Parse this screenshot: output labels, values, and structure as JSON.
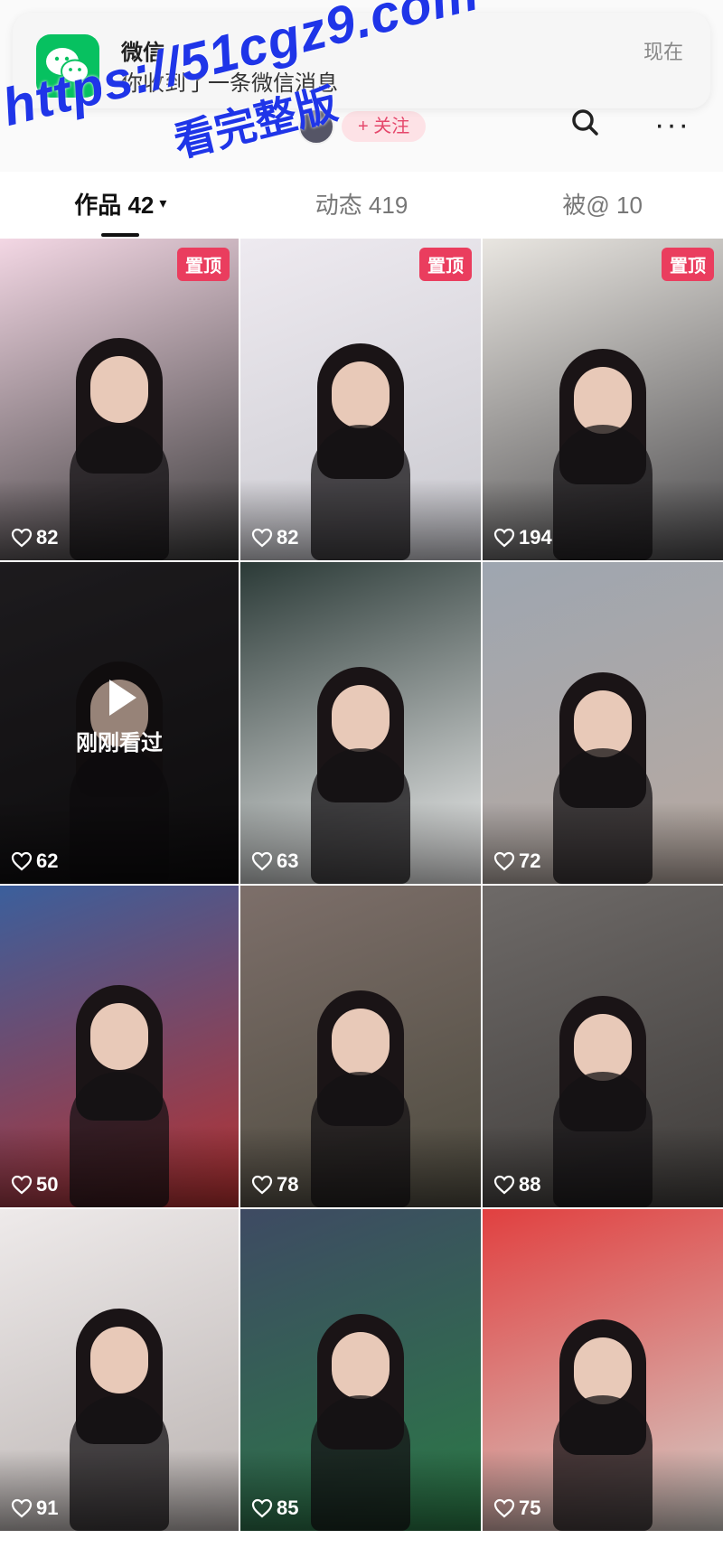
{
  "notification": {
    "app_name": "微信",
    "message": "你收到了一条微信消息",
    "time": "现在"
  },
  "profile": {
    "follow_label": "+ 关注",
    "more_label": "···"
  },
  "tabs": [
    {
      "label": "作品 42",
      "active": true
    },
    {
      "label": "动态 419",
      "active": false
    },
    {
      "label": "被@ 10",
      "active": false
    }
  ],
  "tab_caret": "▾",
  "watermark": {
    "url": "https://51cgz9.com",
    "subtitle": "看完整版"
  },
  "grid": {
    "tiles": [
      {
        "likes": "82",
        "pinned": true,
        "pin_label": "置顶",
        "colors": [
          "#f3d7e4",
          "#3a3a3a"
        ]
      },
      {
        "likes": "82",
        "pinned": true,
        "pin_label": "置顶",
        "colors": [
          "#eeeaf0",
          "#c9c9cf"
        ]
      },
      {
        "likes": "194",
        "pinned": true,
        "pin_label": "置顶",
        "colors": [
          "#e9e6e1",
          "#4b4a4c"
        ]
      },
      {
        "likes": "62",
        "pinned": false,
        "watched": true,
        "watched_label": "刚刚看过",
        "colors": [
          "#2d2a2e",
          "#141214"
        ]
      },
      {
        "likes": "63",
        "pinned": false,
        "colors": [
          "#2b3a37",
          "#f2f2f2"
        ]
      },
      {
        "likes": "72",
        "pinned": false,
        "colors": [
          "#9ea6b0",
          "#b8a9a0"
        ]
      },
      {
        "likes": "50",
        "pinned": false,
        "colors": [
          "#3b5f9c",
          "#b8302f"
        ]
      },
      {
        "likes": "78",
        "pinned": false,
        "colors": [
          "#7d6f6a",
          "#4d4a3e"
        ]
      },
      {
        "likes": "88",
        "pinned": false,
        "colors": [
          "#6e6a68",
          "#3f3c3a"
        ]
      },
      {
        "likes": "91",
        "pinned": false,
        "colors": [
          "#eeeaea",
          "#b9b2b0"
        ]
      },
      {
        "likes": "85",
        "pinned": false,
        "colors": [
          "#3e4a63",
          "#2a7a45"
        ]
      },
      {
        "likes": "75",
        "pinned": false,
        "colors": [
          "#e14040",
          "#d4cec8"
        ]
      }
    ]
  },
  "colors": {
    "pin": "#ea3d5e",
    "wechat_green": "#07c160",
    "watermark_blue": "#1f35e8"
  }
}
